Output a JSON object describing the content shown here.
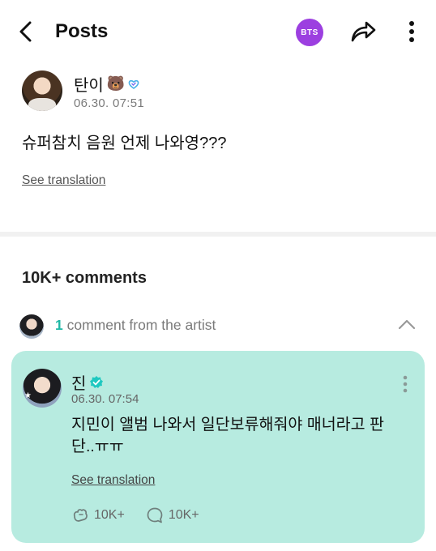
{
  "header": {
    "title": "Posts",
    "group_badge": "BTS",
    "accent": "#9c3fe0"
  },
  "post": {
    "author": "탄이",
    "author_emoji": "🐻",
    "time": "06.30. 07:51",
    "body": "슈퍼참치 음원 언제 나와영???",
    "see_translation": "See translation"
  },
  "comments": {
    "title": "10K+ comments",
    "artist_count": "1",
    "artist_label": "comment from the artist",
    "artist_comment": {
      "author": "진",
      "time": "06.30. 07:54",
      "body": "지민이 앨범 나와서 일단보류해줘야 매너라고 판단..ㅠㅠ",
      "see_translation": "See translation",
      "likes": "10K+",
      "replies": "10K+",
      "card_color": "#b7ebe0",
      "accent": "#1fb8a6"
    }
  },
  "icons": [
    "back-arrow-icon",
    "share-icon",
    "more-vertical-icon",
    "fan-heart-badge-icon",
    "verified-icon",
    "chevron-up-icon",
    "like-icon",
    "reply-icon"
  ]
}
